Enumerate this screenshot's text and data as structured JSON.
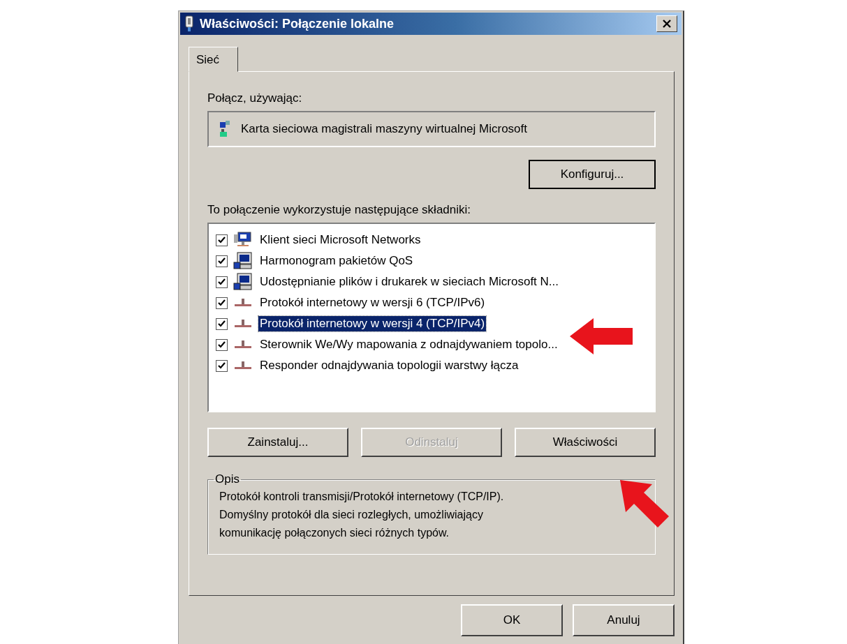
{
  "window": {
    "title": "Właściwości: Połączenie lokalne"
  },
  "tabs": [
    {
      "label": "Sieć",
      "selected": true
    }
  ],
  "connect_using": {
    "label": "Połącz, używając:",
    "adapter": "Karta sieciowa magistrali maszyny wirtualnej Microsoft",
    "configure_button": "Konfiguruj..."
  },
  "components": {
    "label": "To połączenie wykorzystuje następujące składniki:",
    "items": [
      {
        "kind": "client",
        "label": "Klient sieci Microsoft Networks",
        "checked": true,
        "selected": false
      },
      {
        "kind": "service",
        "label": "Harmonogram pakietów QoS",
        "checked": true,
        "selected": false
      },
      {
        "kind": "service",
        "label": "Udostępnianie plików i drukarek w sieciach Microsoft N...",
        "checked": true,
        "selected": false
      },
      {
        "kind": "protocol",
        "label": "Protokół internetowy w wersji 6 (TCP/IPv6)",
        "checked": true,
        "selected": false
      },
      {
        "kind": "protocol",
        "label": "Protokół internetowy w wersji 4 (TCP/IPv4)",
        "checked": true,
        "selected": true
      },
      {
        "kind": "protocol",
        "label": "Sterownik We/Wy mapowania z odnajdywaniem topolo...",
        "checked": true,
        "selected": false
      },
      {
        "kind": "protocol",
        "label": "Responder odnajdywania topologii warstwy łącza",
        "checked": true,
        "selected": false
      }
    ]
  },
  "component_buttons": [
    {
      "label": "Zainstaluj...",
      "disabled": false
    },
    {
      "label": "Odinstaluj",
      "disabled": true
    },
    {
      "label": "Właściwości",
      "disabled": false
    }
  ],
  "description": {
    "title": "Opis",
    "lines": [
      "Protokół kontroli transmisji/Protokół internetowy (TCP/IP).",
      "Domyślny protokół dla sieci rozległych, umożliwiający",
      "komunikację połączonych sieci różnych typów."
    ]
  },
  "dialog_buttons": [
    "OK",
    "Anuluj"
  ]
}
